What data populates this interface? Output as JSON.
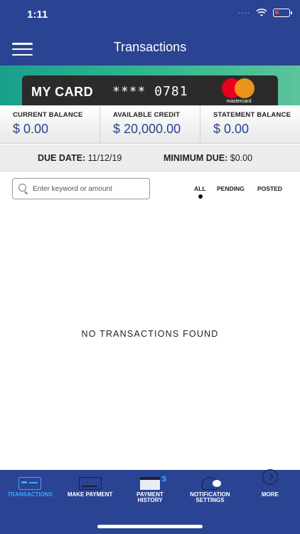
{
  "status_bar": {
    "time": "1:11",
    "signal": "····"
  },
  "header": {
    "title": "Transactions"
  },
  "card": {
    "name": "MY CARD",
    "masked_number": "**** 0781",
    "brand": "mastercard"
  },
  "balances": [
    {
      "label": "CURRENT BALANCE",
      "value": "$ 0.00"
    },
    {
      "label": "AVAILABLE CREDIT",
      "value": "$ 20,000.00"
    },
    {
      "label": "STATEMENT BALANCE",
      "value": "$ 0.00"
    }
  ],
  "due": {
    "due_date_label": "DUE DATE:",
    "due_date_value": "11/12/19",
    "minimum_due_label": "MINIMUM DUE:",
    "minimum_due_value": "$0.00"
  },
  "search": {
    "placeholder": "Enter keyword or amount"
  },
  "filters": {
    "all": "ALL",
    "pending": "PENDING",
    "posted": "POSTED",
    "selected": "ALL"
  },
  "empty_message": "NO TRANSACTIONS FOUND",
  "bottom_nav": [
    {
      "label": "TRANSACTIONS",
      "icon": "credit-card-icon",
      "active": true
    },
    {
      "label": "MAKE PAYMENT",
      "icon": "card-payment-icon",
      "active": false
    },
    {
      "label": "PAYMENT\nHISTORY",
      "icon": "calendar-dollar-icon",
      "active": false
    },
    {
      "label": "NOTIFICATION\nSETTINGS",
      "icon": "bell-icon",
      "active": false
    },
    {
      "label": "MORE",
      "icon": "chevron-circle-icon",
      "active": false
    }
  ],
  "colors": {
    "brand_blue": "#2a4393",
    "active_blue": "#3aa6ff",
    "card_green": "#35b890"
  }
}
